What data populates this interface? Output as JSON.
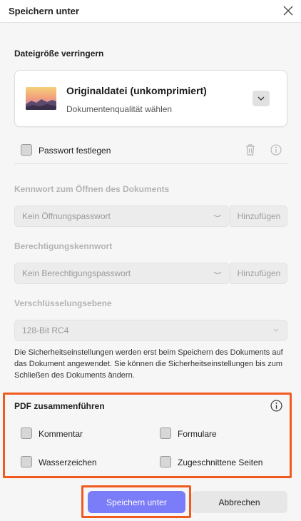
{
  "window": {
    "title": "Speichern unter",
    "close_icon": "close-icon"
  },
  "reduce_size": {
    "heading": "Dateigröße verringern",
    "selected_title": "Originaldatei (unkomprimiert)",
    "selected_subtitle": "Dokumentenqualität wählen"
  },
  "password": {
    "checkbox_label": "Passwort festlegen",
    "checked": false,
    "open_label": "Kennwort zum Öffnen des Dokuments",
    "open_placeholder": "Kein Öffnungspasswort",
    "open_add": "Hinzufügen",
    "permission_label": "Berechtigungskennwort",
    "permission_placeholder": "Kein Berechtigungspasswort",
    "permission_add": "Hinzufügen",
    "encryption_label": "Verschlüsselungsebene",
    "encryption_value": "128-Bit RC4",
    "note": "Die Sicherheitseinstellungen werden erst beim Speichern des Dokuments auf das Dokument angewendet. Sie können die Sicherheitseinstellungen bis zum Schließen des Dokuments ändern."
  },
  "merge": {
    "heading": "PDF zusammenführen",
    "options": [
      {
        "label": "Kommentar",
        "checked": false
      },
      {
        "label": "Formulare",
        "checked": false
      },
      {
        "label": "Wasserzeichen",
        "checked": false
      },
      {
        "label": "Zugeschnittene Seiten",
        "checked": false
      }
    ]
  },
  "actions": {
    "save": "Speichern unter",
    "cancel": "Abbrechen"
  },
  "colors": {
    "primary": "#7b7cf7",
    "highlight": "#f15a1f"
  }
}
